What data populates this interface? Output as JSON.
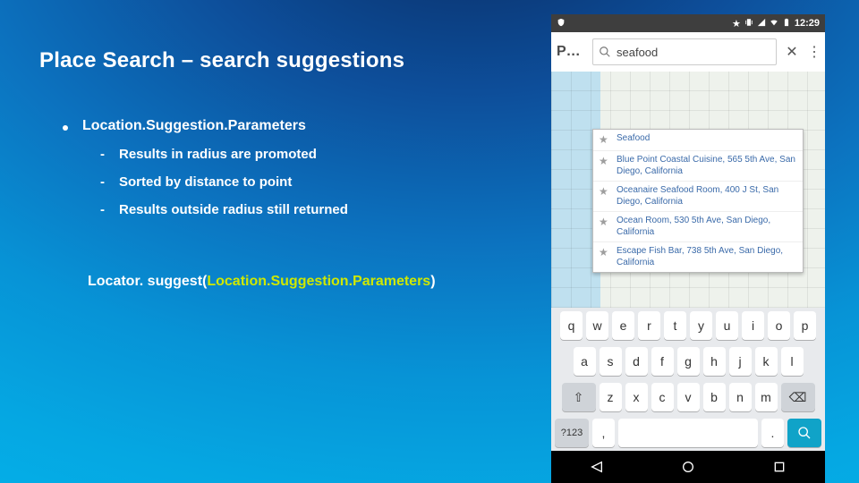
{
  "slide": {
    "title": "Place Search – search suggestions",
    "bullet_main": "Location.Suggestion.Parameters",
    "sub_bullets": [
      "Results in radius are promoted",
      "Sorted by distance to point",
      "Results outside radius still returned"
    ],
    "code": {
      "prefix": "Locator. suggest(",
      "param": "Location.Suggestion.Parameters",
      "suffix": ")"
    }
  },
  "phone": {
    "status": {
      "time": "12:29"
    },
    "toolbar": {
      "back_label": "P…",
      "search_text": "seafood"
    },
    "suggestions": [
      "Seafood",
      "Blue Point Coastal Cuisine, 565 5th Ave, San Diego, California",
      "Oceanaire Seafood Room, 400 J St, San Diego, California",
      "Ocean Room, 530 5th Ave, San Diego, California",
      "Escape Fish Bar, 738 5th Ave, San Diego, California"
    ],
    "keyboard": {
      "row1": [
        "q",
        "w",
        "e",
        "r",
        "t",
        "y",
        "u",
        "i",
        "o",
        "p"
      ],
      "row2": [
        "a",
        "s",
        "d",
        "f",
        "g",
        "h",
        "j",
        "k",
        "l"
      ],
      "row3_shift": "⇧",
      "row3": [
        "z",
        "x",
        "c",
        "v",
        "b",
        "n",
        "m"
      ],
      "row3_back": "⌫",
      "row4_sym": "?123",
      "row4_comma": ",",
      "row4_period": "."
    }
  }
}
